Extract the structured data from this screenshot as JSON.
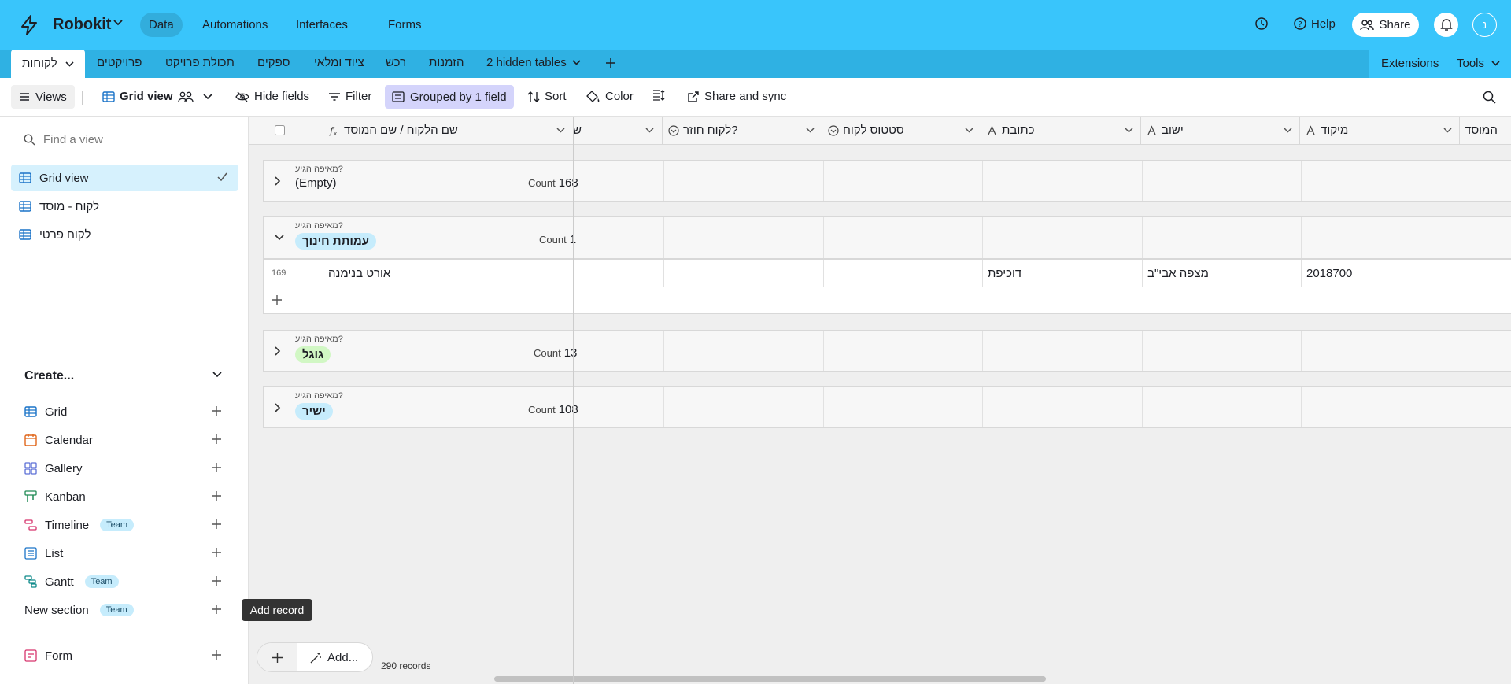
{
  "topbar": {
    "base_name": "Robokit",
    "nav": [
      "Data",
      "Automations",
      "Interfaces",
      "Forms"
    ],
    "help_label": "Help",
    "share_label": "Share",
    "avatar_initial": "נ"
  },
  "tables": {
    "active": "לקוחות",
    "others": [
      "פרויקטים",
      "תכולת פרויקט",
      "ספקים",
      "ציוד ומלאי",
      "רכש",
      "הזמנות"
    ],
    "hidden": "2 hidden tables",
    "extensions": "Extensions",
    "tools": "Tools"
  },
  "viewbar": {
    "views": "Views",
    "grid_view": "Grid view",
    "hide_fields": "Hide fields",
    "filter": "Filter",
    "grouped": "Grouped by 1 field",
    "sort": "Sort",
    "color": "Color",
    "share_sync": "Share and sync"
  },
  "sidebar": {
    "find_placeholder": "Find a view",
    "views": [
      "Grid view",
      "לקוח - מוסד",
      "לקוח פרטי"
    ],
    "create_title": "Create...",
    "create_items": [
      {
        "label": "Grid",
        "team": ""
      },
      {
        "label": "Calendar",
        "team": ""
      },
      {
        "label": "Gallery",
        "team": ""
      },
      {
        "label": "Kanban",
        "team": ""
      },
      {
        "label": "Timeline",
        "team": "Team"
      },
      {
        "label": "List",
        "team": ""
      },
      {
        "label": "Gantt",
        "team": "Team"
      }
    ],
    "new_section": "New section",
    "new_section_badge": "Team",
    "form": "Form",
    "tooltip": "Add record"
  },
  "grid": {
    "columns": {
      "primary": "שם הלקוח / שם המוסד",
      "partial": "ש",
      "returning": "לקוח חוזר?",
      "status": "סטטוס לקוח",
      "address": "כתובת",
      "city": "ישוב",
      "zip": "מיקוד",
      "institution": "המוסד"
    },
    "group_field": "מאיפה הגיע?",
    "count_label": "Count",
    "groups": [
      {
        "value": "(Empty)",
        "count": "168"
      },
      {
        "value": "עמותת חינוך",
        "count": "1"
      },
      {
        "value": "גוגל",
        "count": "13"
      },
      {
        "value": "ישיר",
        "count": "108"
      }
    ],
    "row": {
      "num": "169",
      "name": "אורט בנימנה",
      "address": "דוכיפת",
      "city": "מצפה אבי\"ב",
      "zip": "2018700"
    },
    "add_label": "Add...",
    "records": "290 records"
  },
  "colors": {
    "topbar": "#39c5fb",
    "tabsbar": "#2fb1e3",
    "grouped_bg": "#d4d4fb",
    "selected_view": "#d6f1fd",
    "pill_blue": "#c6ecfc",
    "pill_green": "#d1f7c4"
  },
  "icons": [
    "lightning-logo",
    "history-icon",
    "help-icon",
    "share-people-icon",
    "bell-icon",
    "chevron-down-icon",
    "plus-icon",
    "hamburger-icon",
    "grid-icon",
    "people-icon",
    "eye-slash-icon",
    "filter-icon",
    "group-icon",
    "sort-icon",
    "color-bucket-icon",
    "row-height-icon",
    "share-external-icon",
    "search-icon",
    "check-icon",
    "calendar-icon",
    "gallery-icon",
    "kanban-icon",
    "timeline-icon",
    "list-icon",
    "gantt-icon",
    "form-icon",
    "formula-icon",
    "dropdown-circle-icon",
    "text-a-icon",
    "magic-wand-icon"
  ]
}
